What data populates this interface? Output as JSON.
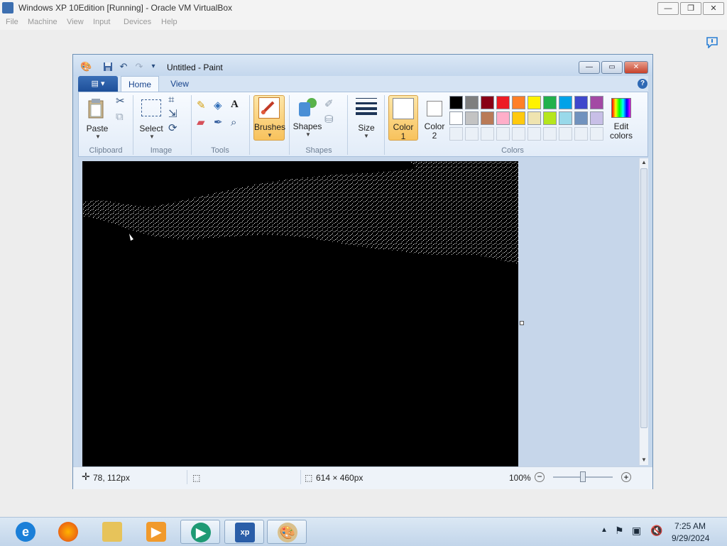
{
  "host": {
    "title": "Windows XP 10Edition [Running] - Oracle VM VirtualBox",
    "menu": [
      "File",
      "Machine",
      "View",
      "Input",
      "Devices",
      "Help"
    ],
    "window_buttons": {
      "minimize": "—",
      "restore": "❐",
      "close": "✕"
    }
  },
  "paint": {
    "title": "Untitled - Paint",
    "tabs": {
      "home": "Home",
      "view": "View"
    },
    "groups": {
      "clipboard": "Clipboard",
      "image": "Image",
      "tools": "Tools",
      "shapes": "Shapes",
      "colors": "Colors"
    },
    "buttons": {
      "paste": "Paste",
      "select": "Select",
      "brushes": "Brushes",
      "shapes": "Shapes",
      "size": "Size",
      "color1_line1": "Color",
      "color1_line2": "1",
      "color2_line1": "Color",
      "color2_line2": "2",
      "edit_colors_line1": "Edit",
      "edit_colors_line2": "colors"
    },
    "palette_row1": [
      "#000000",
      "#7f7f7f",
      "#880015",
      "#ed1c24",
      "#ff7f27",
      "#fff200",
      "#22b14c",
      "#00a2e8",
      "#3f48cc",
      "#a349a4"
    ],
    "palette_row2": [
      "#ffffff",
      "#c3c3c3",
      "#b97a57",
      "#ffaec9",
      "#ffc90e",
      "#efe4b0",
      "#b5e61d",
      "#99d9ea",
      "#7092be",
      "#c8bfe7"
    ],
    "status": {
      "cursor_pos": "78, 112px",
      "canvas_size": "614 × 460px",
      "zoom": "100%"
    }
  },
  "taskbar": {
    "time": "7:25 AM",
    "date": "9/29/2024"
  }
}
